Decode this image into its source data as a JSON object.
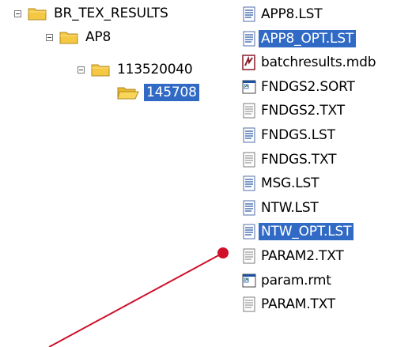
{
  "tree": {
    "root": {
      "label": "BR_TEX_RESULTS"
    },
    "child": {
      "label": "AP8"
    },
    "grandchild": {
      "label": "113520040"
    },
    "leaf": {
      "label": "145708"
    }
  },
  "files": [
    {
      "name": "APP8.LST",
      "icon": "list-file-icon",
      "selected": false
    },
    {
      "name": "APP8_OPT.LST",
      "icon": "list-file-icon",
      "selected": true
    },
    {
      "name": "batchresults.mdb",
      "icon": "database-file-icon",
      "selected": false
    },
    {
      "name": "FNDGS2.SORT",
      "icon": "window-file-icon",
      "selected": false
    },
    {
      "name": "FNDGS2.TXT",
      "icon": "text-file-icon",
      "selected": false
    },
    {
      "name": "FNDGS.LST",
      "icon": "list-file-icon",
      "selected": false
    },
    {
      "name": "FNDGS.TXT",
      "icon": "text-file-icon",
      "selected": false
    },
    {
      "name": "MSG.LST",
      "icon": "list-file-icon",
      "selected": false
    },
    {
      "name": "NTW.LST",
      "icon": "list-file-icon",
      "selected": false
    },
    {
      "name": "NTW_OPT.LST",
      "icon": "list-file-icon",
      "selected": true
    },
    {
      "name": "PARAM2.TXT",
      "icon": "text-file-icon",
      "selected": false
    },
    {
      "name": "param.rmt",
      "icon": "window-file-icon",
      "selected": false
    },
    {
      "name": "PARAM.TXT",
      "icon": "text-file-icon",
      "selected": false
    }
  ],
  "colors": {
    "selection": "#316ac5",
    "folder": "#f5c843",
    "pointer": "#d0102a"
  }
}
